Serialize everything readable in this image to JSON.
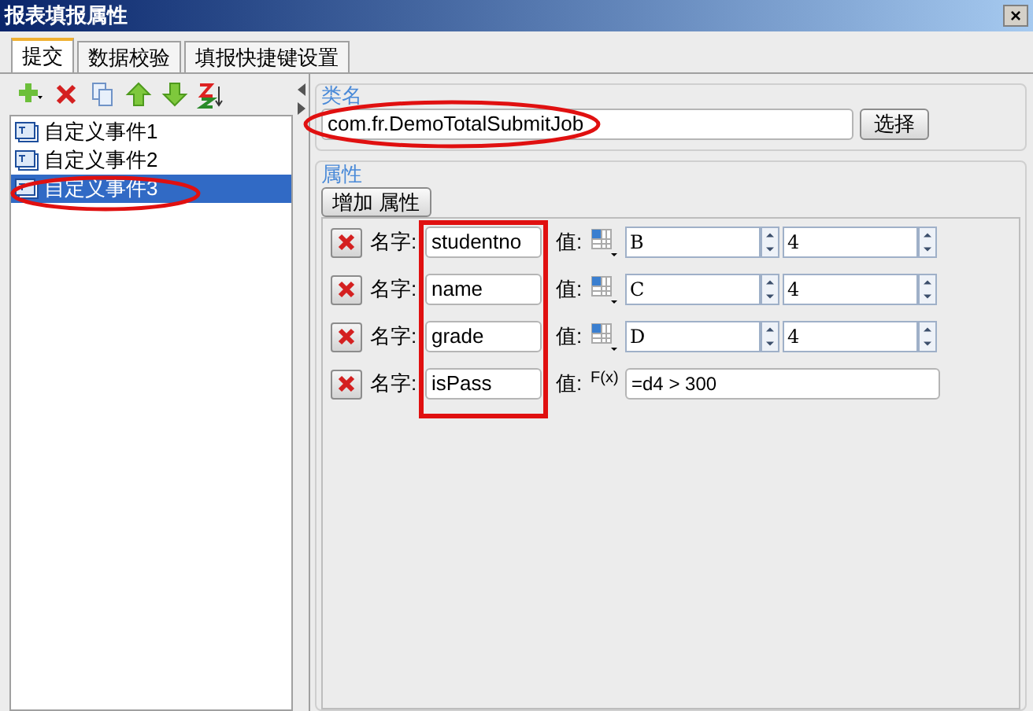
{
  "window": {
    "title": "报表填报属性",
    "close": "×"
  },
  "tabs": [
    {
      "label": "提交",
      "selected": true
    },
    {
      "label": "数据校验",
      "selected": false
    },
    {
      "label": "填报快捷键设置",
      "selected": false
    }
  ],
  "events": [
    {
      "label": "自定义事件1",
      "selected": false
    },
    {
      "label": "自定义事件2",
      "selected": false
    },
    {
      "label": "自定义事件3",
      "selected": true
    }
  ],
  "class_name": {
    "legend": "类名",
    "value": "com.fr.DemoTotalSubmitJob",
    "button": "选择"
  },
  "properties": {
    "legend": "属性",
    "add_button": "增加 属性",
    "rows": [
      {
        "name_label": "名字:",
        "name": "studentno",
        "value_label": "值:",
        "value": {
          "kind": "cell",
          "column": "B",
          "row": "4"
        }
      },
      {
        "name_label": "名字:",
        "name": "name",
        "value_label": "值:",
        "value": {
          "kind": "cell",
          "column": "C",
          "row": "4"
        }
      },
      {
        "name_label": "名字:",
        "name": "grade",
        "value_label": "值:",
        "value": {
          "kind": "cell",
          "column": "D",
          "row": "4"
        }
      },
      {
        "name_label": "名字:",
        "name": "isPass",
        "value_label": "值:",
        "value": {
          "kind": "formula",
          "icon_label": "F(x)",
          "text": "=d4 > 300"
        }
      }
    ]
  }
}
